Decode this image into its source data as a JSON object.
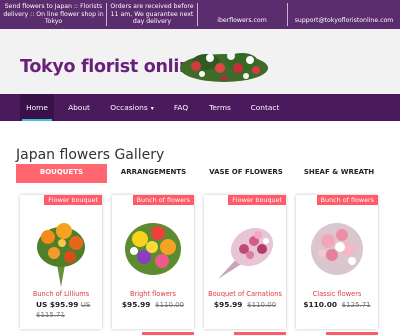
{
  "topbar": {
    "intro": "Send flowers to Japan :: Florists delivery :: On line flower shop in Tokyo",
    "hours": "Orders are received before 11 am, We guarantee next day delivery",
    "site": "iberflowers.com",
    "email": "support@tokyofloristonline.com"
  },
  "header": {
    "logo_text": "Tokyo florist online"
  },
  "nav": {
    "items": [
      {
        "label": "Home"
      },
      {
        "label": "About"
      },
      {
        "label": "Occasions"
      },
      {
        "label": "FAQ"
      },
      {
        "label": "Terms"
      },
      {
        "label": "Contact"
      }
    ]
  },
  "gallery": {
    "title": "Japan flowers Gallery",
    "tabs": [
      {
        "label": "BOUQUETS"
      },
      {
        "label": "ARRANGEMENTS"
      },
      {
        "label": "VASE OF FLOWERS"
      },
      {
        "label": "SHEAF & WREATH"
      }
    ],
    "products": [
      {
        "badge": "Flower bouquet",
        "name": "Bunch of Lilliums",
        "price": "US $95.99",
        "old_price_a": "US",
        "old_price_b": "$115.71"
      },
      {
        "badge": "Bunch of flowers",
        "name": "Bright flowers",
        "price": "$95.99",
        "old_price": "$110.00"
      },
      {
        "badge": "Flower bouquet",
        "name": "Bouquet of Carnations",
        "price": "$95.99",
        "old_price": "$110.00"
      },
      {
        "badge": "Bunch of flowers",
        "name": "Classic flowers",
        "price": "$110.00",
        "old_price": "$125.71"
      }
    ]
  },
  "colors": {
    "topbar": "#5b2d6e",
    "nav": "#4a1a5c",
    "accent": "#ff6670",
    "logo": "#6a1f7a"
  }
}
